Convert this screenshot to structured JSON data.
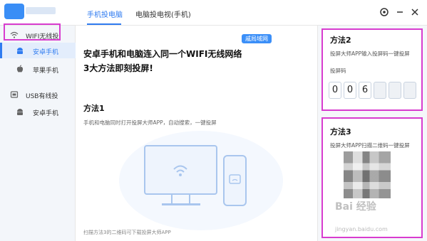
{
  "topbar": {
    "tabs": [
      {
        "label": "手机投电脑"
      },
      {
        "label": "电脑投电视(手机)"
      }
    ]
  },
  "sidebar": {
    "items": [
      {
        "label": "WIFI无线投"
      },
      {
        "label": "安卓手机"
      },
      {
        "label": "苹果手机"
      },
      {
        "label": "USB有线投"
      },
      {
        "label": "安卓手机"
      }
    ]
  },
  "main": {
    "badge": "戚局域网",
    "headline_line1": "安卓手机和电脑连入同一个WIFI无线网络",
    "headline_line2": "3大方法即刻投屏!",
    "method1_title": "方法1",
    "method1_desc": "手机和电脑同时打开投屏大师APP，自动搜索，一键投屏",
    "footer": "扫描方法3的二维码可下载投屏大师APP"
  },
  "right": {
    "method2_title": "方法2",
    "method2_desc": "投屏大师APP输入投屏码一键投屏",
    "code_label": "投屏码",
    "code_digits": [
      "0",
      "0",
      "6",
      "",
      "",
      ""
    ],
    "method3_title": "方法3",
    "method3_desc": "投屏大师APP扫描二维码一键投屏",
    "watermark": "Bai 经验",
    "watermark_sub": "jingyan.baidu.com"
  }
}
